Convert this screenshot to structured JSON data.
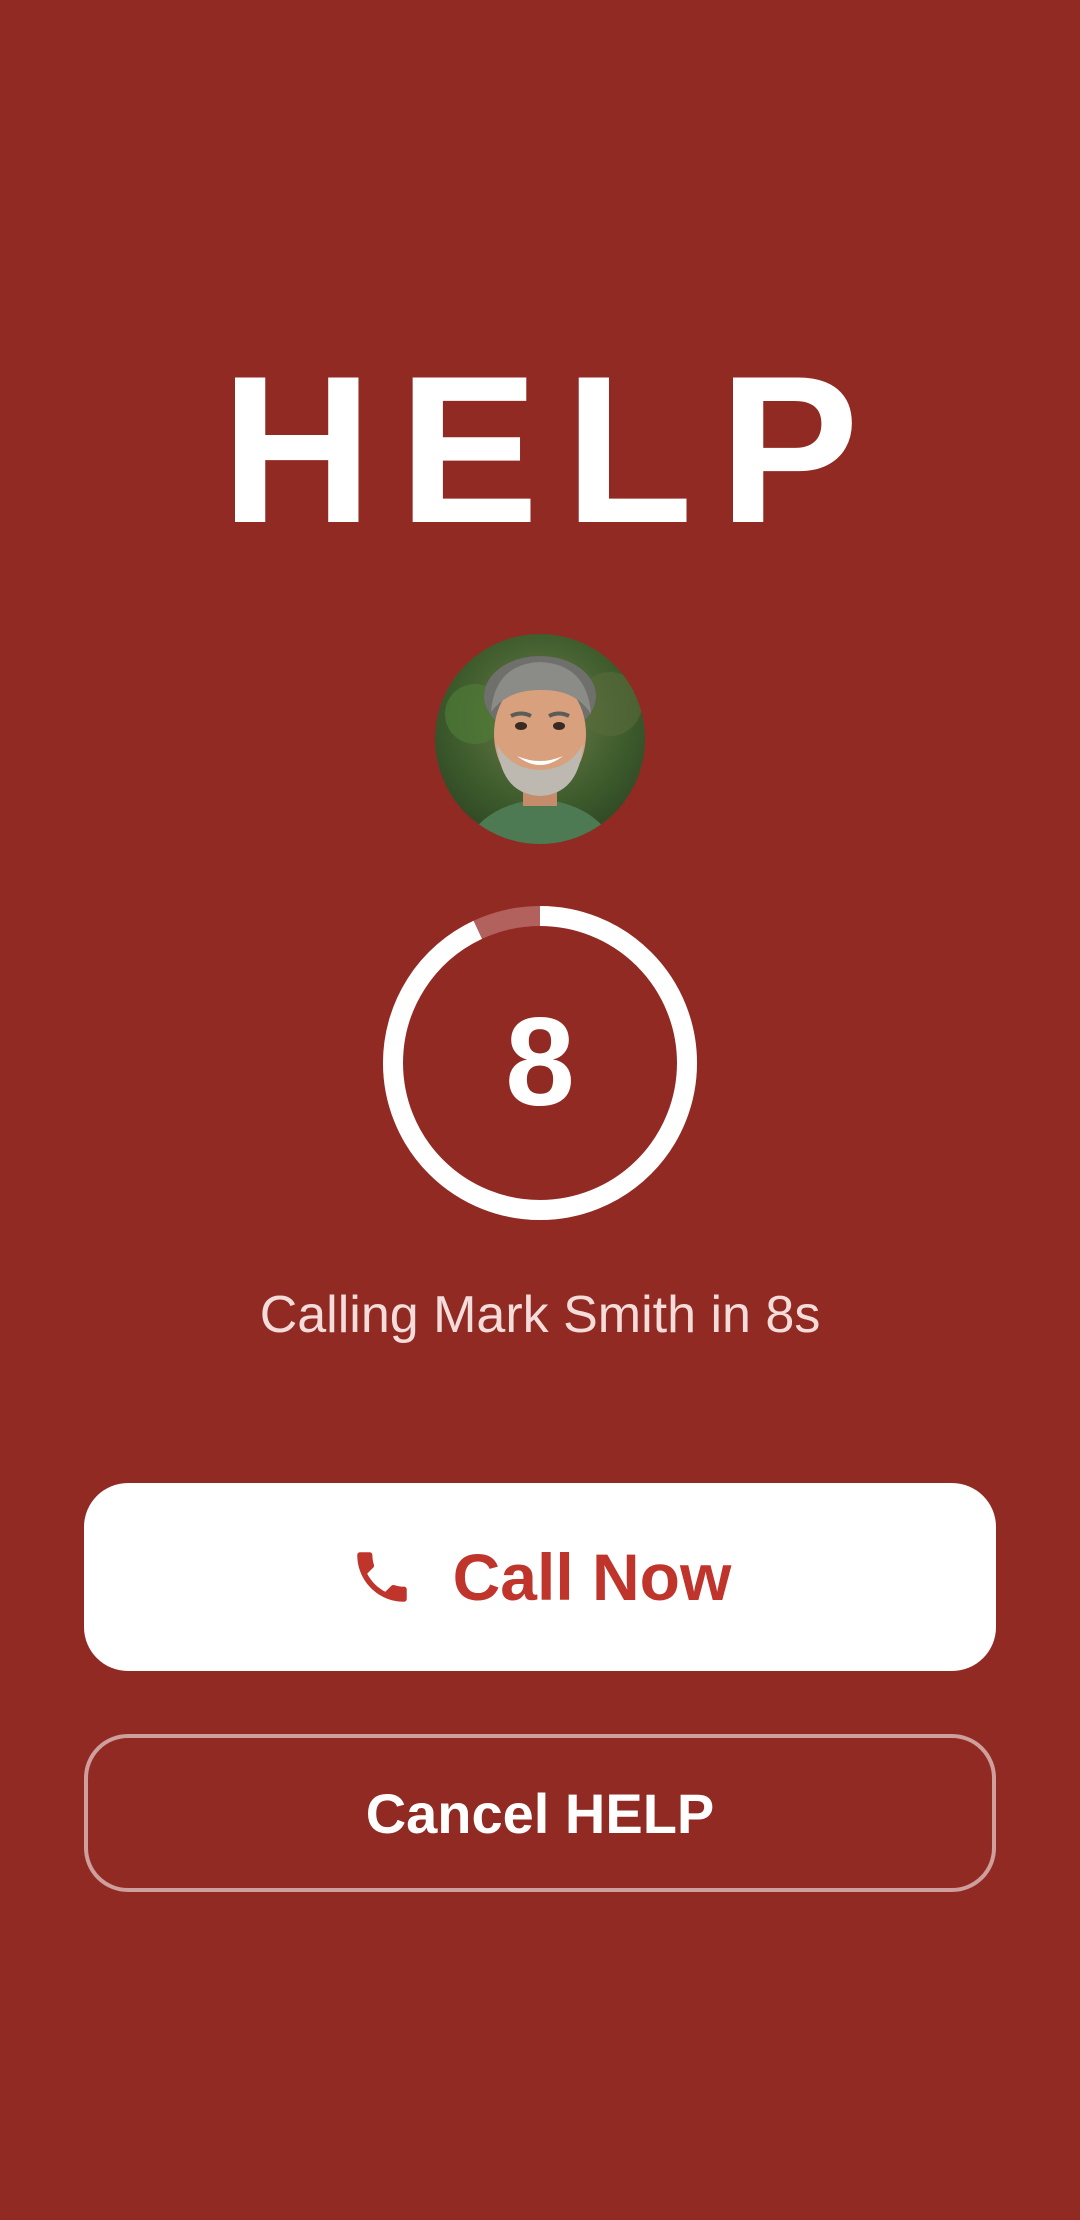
{
  "header": {
    "title": "HELP"
  },
  "contact": {
    "name": "Mark Smith"
  },
  "countdown": {
    "seconds_remaining": 8,
    "display": "8",
    "progress_fraction": 0.93,
    "status_text": "Calling Mark Smith in 8s"
  },
  "actions": {
    "call_now_label": "Call Now",
    "call_icon": "phone-icon",
    "cancel_label": "Cancel HELP"
  },
  "colors": {
    "background": "#922a24",
    "accent": "#c0352b",
    "button_bg": "#ffffff",
    "ring": "#ffffff",
    "ring_track": "#b2615c"
  }
}
